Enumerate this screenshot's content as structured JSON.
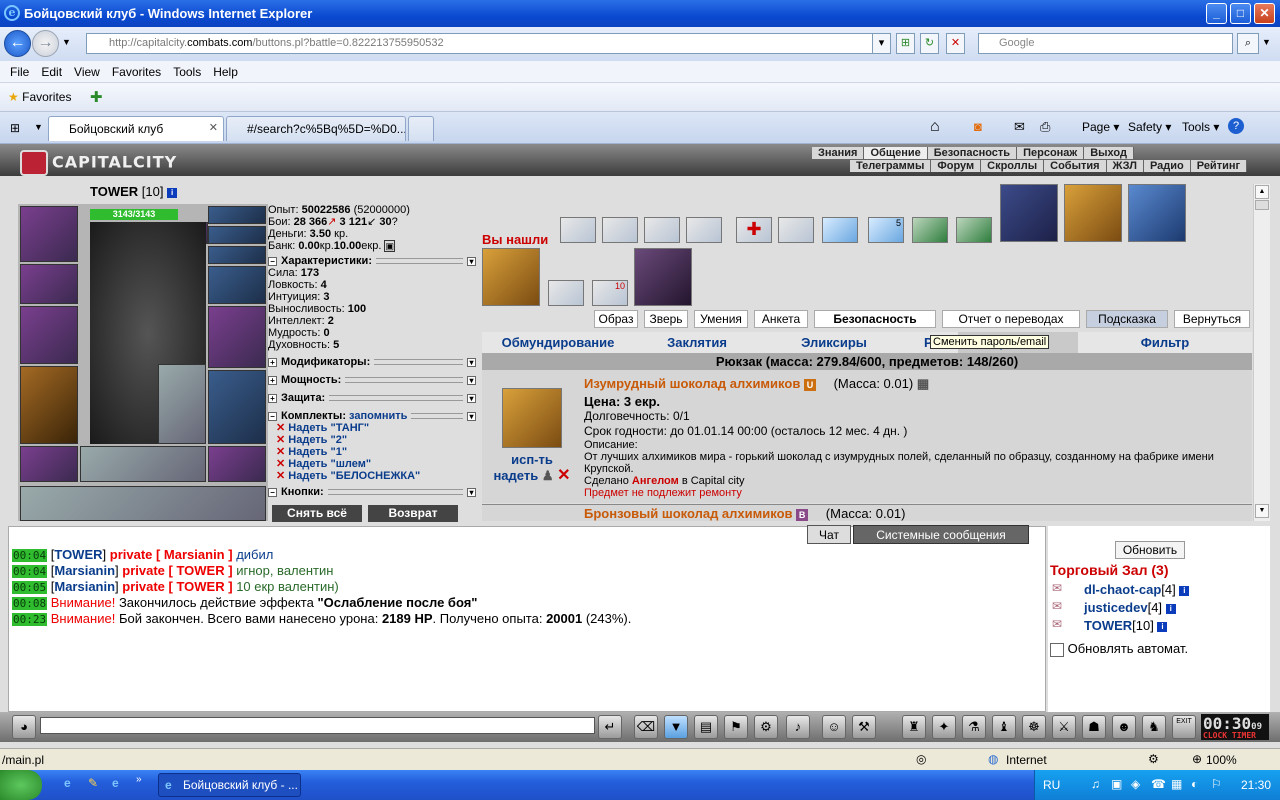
{
  "window": {
    "title": "Бойцовский клуб - Windows Internet Explorer"
  },
  "address": {
    "url_prefix": "http://capitalcity.",
    "url_domain": "combats.com",
    "url_suffix": "/buttons.pl?battle=0.822213755950532",
    "search_placeholder": "Google"
  },
  "menu": [
    "File",
    "Edit",
    "View",
    "Favorites",
    "Tools",
    "Help"
  ],
  "favorites": {
    "label": "Favorites"
  },
  "tabs": [
    {
      "label": "Бойцовский клуб"
    },
    {
      "label": "#/search?c%5Bq%5D=%D0..."
    }
  ],
  "commands": [
    "Page ▾",
    "Safety ▾",
    "Tools ▾"
  ],
  "site": {
    "logo": "CAPITALCITY",
    "nav1": [
      "Знания",
      "Общение",
      "Безопасность",
      "Персонаж",
      "Выход"
    ],
    "nav2": [
      "Телеграммы",
      "Форум",
      "Скроллы",
      "События",
      "ЖЗЛ",
      "Радио",
      "Рейтинг"
    ]
  },
  "character": {
    "name": "TOWER",
    "level": "[10]",
    "hp": "3143/3143"
  },
  "stats": {
    "exp_label": "Опыт:",
    "exp_value": "50022586",
    "exp_next": "(52000000)",
    "fights_label": "Бои:",
    "fights_wins": "28 366",
    "fights_losses": "3 121",
    "fights_draws": "30",
    "money_label": "Деньги:",
    "money_value": "3.50",
    "money_unit": "кр.",
    "bank_label": "Банк:",
    "bank_value": "0.00",
    "bank_unit1": "кр.",
    "bank_value2": "10.00",
    "bank_unit2": "екр.",
    "characteristics_header": "Характеристики:",
    "attributes": [
      {
        "label": "Сила:",
        "value": "173"
      },
      {
        "label": "Ловкость:",
        "value": "4"
      },
      {
        "label": "Интуиция:",
        "value": "3"
      },
      {
        "label": "Выносливость:",
        "value": "100"
      },
      {
        "label": "Интеллект:",
        "value": "2"
      },
      {
        "label": "Мудрость:",
        "value": "0"
      },
      {
        "label": "Духовность:",
        "value": "5"
      }
    ],
    "modifiers_header": "Модификаторы:",
    "power_header": "Мощность:",
    "defense_header": "Защита:",
    "kits_header": "Комплекты:",
    "kits_remember": "запомнить",
    "kits": [
      "Надеть \"ТАНГ\"",
      "Надеть \"2\"",
      "Надеть \"1\"",
      "Надеть \"шлем\"",
      "Надеть \"БЕЛОСНЕЖКА\""
    ],
    "buttons_header": "Кнопки:",
    "btn_remove_all": "Снять всё",
    "btn_return": "Возврат"
  },
  "found": {
    "label": "Вы нашли"
  },
  "belt_counts": {
    "slot_a": "5",
    "slot_b": "10"
  },
  "action_tabs": [
    "Образ",
    "Зверь",
    "Умения",
    "Анкета",
    "Безопасность",
    "Отчет о переводах",
    "Подсказка",
    "Вернуться"
  ],
  "tooltip": "Сменить пароль/email",
  "categories": [
    "Обмундирование",
    "Заклятия",
    "Эликсиры",
    "Р",
    "рочее",
    "Фильтр"
  ],
  "backpack": {
    "title": "Рюкзак (масса: 279.84/600, предметов: 148/260)"
  },
  "items": [
    {
      "name": "Изумрудный шоколад алхимиков",
      "badge": "U",
      "mass": "(Масса: 0.01)",
      "price": "Цена: 3 екр.",
      "durability": "Долговечность: 0/1",
      "expiry": "Срок годности: до 01.01.14 00:00 (осталось 12 мес. 4 дн. )",
      "desc_label": "Описание:",
      "desc": "От лучших алхимиков мира - горький шоколад с изумрудных полей, сделанный по образцу, созданному на фабрике имени Крупской.",
      "made_prefix": "Сделано",
      "made_by": "Ангелом",
      "made_suffix": "в Capital city",
      "no_repair": "Предмет не подлежит ремонту",
      "action_use": "исп-ть",
      "action_wear": "надеть"
    },
    {
      "name": "Бронзовый шоколад алхимиков",
      "badge": "B",
      "mass": "(Масса: 0.01)"
    }
  ],
  "chat": {
    "tab_chat": "Чат",
    "tab_system": "Системные сообщения",
    "lines": [
      {
        "time": "00:04",
        "from": "TOWER",
        "priv": "private [ Marsianin ]",
        "text": "дибил"
      },
      {
        "time": "00:04",
        "from": "Marsianin",
        "priv": "private [ TOWER ]",
        "text": "игнор, валентин"
      },
      {
        "time": "00:05",
        "from": "Marsianin",
        "priv": "private [ TOWER ]",
        "text": "10 екр валентин)"
      }
    ],
    "sys1": {
      "time": "00:08",
      "warn": "Внимание!",
      "text": "Закончилось действие эффекта",
      "effect": "\"Ослабление после боя\""
    },
    "sys2": {
      "time": "00:23",
      "warn": "Внимание!",
      "text1": "Бой закончен. Всего вами нанесено урона:",
      "dmg": "2189 HP",
      "text2": ". Получено опыта:",
      "exp": "20001",
      "text3": "(243%)."
    }
  },
  "trade": {
    "refresh": "Обновить",
    "title": "Торговый Зал (3)",
    "users": [
      {
        "name": "dl-chaot-cap",
        "level": "[4]"
      },
      {
        "name": "justicedev",
        "level": "[4]"
      },
      {
        "name": "TOWER",
        "level": "[10]"
      }
    ],
    "auto": "Обновлять автомат."
  },
  "clock": {
    "time": "00:30",
    "sec": "09",
    "label": "CLOCK TIMER"
  },
  "status": {
    "left": "/main.pl",
    "zone": "Internet",
    "zoom": "100%"
  },
  "taskbar": {
    "item": "Бойцовский клуб - ...",
    "lang": "RU",
    "time": "21:30"
  },
  "colors": {
    "accent_blue": "#0a3c8c",
    "warn_red": "#e00000",
    "hp_green": "#2fbd2f",
    "item_orange": "#c85a08"
  }
}
